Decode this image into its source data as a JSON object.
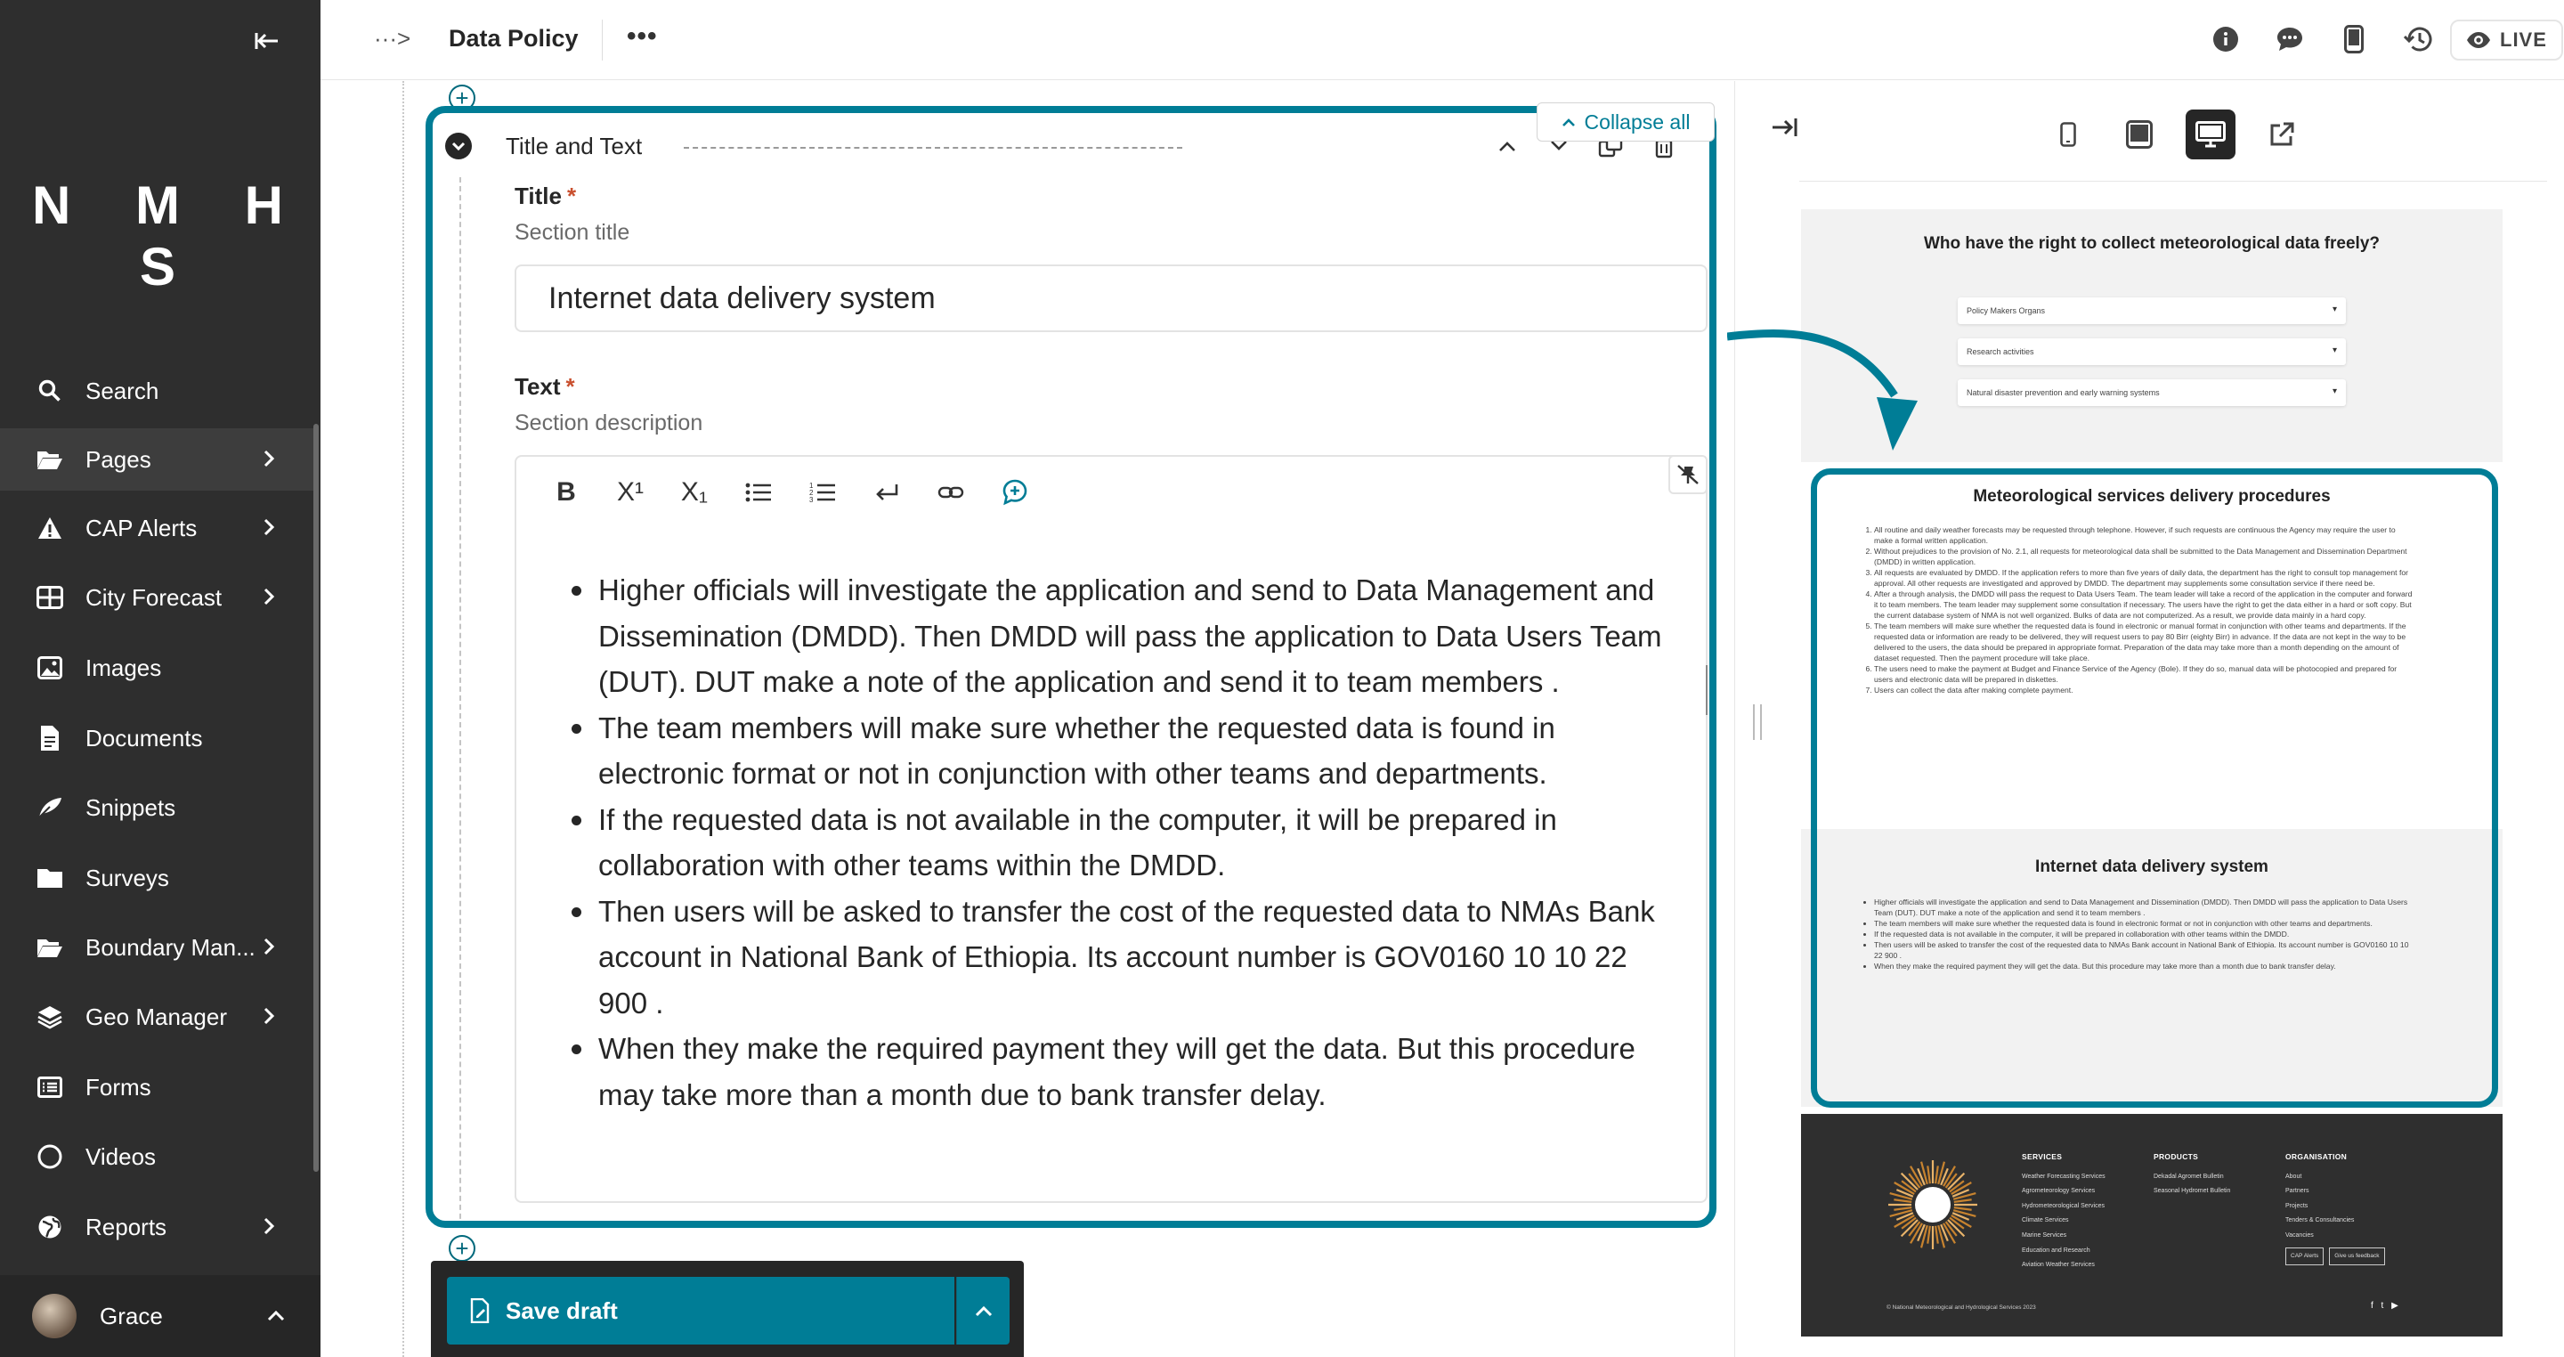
{
  "colors": {
    "sidebar_bg": "#2e2e2e",
    "accent": "#007d96",
    "required": "#c9502f"
  },
  "sidebar": {
    "logo": "N M H S",
    "items": [
      {
        "label": "Search",
        "icon": "search-icon",
        "has_children": false
      },
      {
        "label": "Pages",
        "icon": "folder-open-icon",
        "has_children": true
      },
      {
        "label": "CAP Alerts",
        "icon": "warning-icon",
        "has_children": true
      },
      {
        "label": "City Forecast",
        "icon": "table-icon",
        "has_children": true
      },
      {
        "label": "Images",
        "icon": "image-icon",
        "has_children": false
      },
      {
        "label": "Documents",
        "icon": "doc-icon",
        "has_children": false
      },
      {
        "label": "Snippets",
        "icon": "snippet-icon",
        "has_children": false
      },
      {
        "label": "Surveys",
        "icon": "folder-icon",
        "has_children": false
      },
      {
        "label": "Boundary Man...",
        "icon": "folder-open-icon",
        "has_children": true
      },
      {
        "label": "Geo Manager",
        "icon": "layers-icon",
        "has_children": true
      },
      {
        "label": "Forms",
        "icon": "list-icon",
        "has_children": false
      },
      {
        "label": "Videos",
        "icon": "circle-icon",
        "has_children": false
      },
      {
        "label": "Reports",
        "icon": "globe-icon",
        "has_children": true
      }
    ],
    "user": "Grace"
  },
  "header": {
    "breadcrumb_toggle": "···>",
    "title": "Data Policy",
    "more": "•••",
    "live": "LIVE"
  },
  "editor": {
    "collapse_all": "Collapse all",
    "block_title": "Title and Text",
    "title_field": {
      "label": "Title",
      "help": "Section title",
      "value": "Internet data delivery system"
    },
    "text_field": {
      "label": "Text",
      "help": "Section description"
    },
    "toolbar": {
      "bold": "B",
      "superscript": "X¹",
      "subscript": "X₁"
    },
    "bullets": [
      "Higher officials will investigate the application and send to Data Management and Dissemination (DMDD). Then DMDD will pass the application to Data Users Team (DUT). DUT make a note of the application and send it to team members .",
      "The team members will make sure whether the requested data is found in electronic format or not in conjunction with other teams and departments.",
      "If the requested data is not available in the computer, it will be prepared in collaboration with other teams within the DMDD.",
      "Then users will be asked to transfer the cost of the requested data to NMAs Bank account in National Bank of Ethiopia. Its account number is GOV0160 10 10 22 900 .",
      "When they make the required payment they will get the data. But this procedure may take more than a month due to bank transfer delay."
    ],
    "save_draft": "Save draft"
  },
  "preview": {
    "q_heading": "Who have the right to collect meteorological data freely?",
    "accordions": [
      "Policy Makers Organs",
      "Research activities",
      "Natural disaster prevention and early warning systems"
    ],
    "proc_heading": "Meteorological services delivery procedures",
    "proc_items": [
      "All routine and daily weather forecasts may be requested through telephone. However, if such requests are continuous the Agency may require the user to make a formal written application.",
      "Without prejudices to the provision of No. 2.1, all requests for meteorological data shall be submitted to the Data Management and Dissemination Department (DMDD) in written application.",
      "All requests are evaluated by DMDD. If the application refers to more than five years of daily data, the department has the right to consult top management for approval. All other requests are investigated and approved by DMDD. The department may supplements some consultation service if there need be.",
      "After a through analysis, the DMDD will pass the request to Data Users Team. The team leader will take a record of the application in the computer and forward it to team members. The team leader may supplement some consultation if necessary. The users have the right to get the data either in a hard or soft copy. But the current database system of NMA is not well organized. Bulks of data are not computerized. As a result, we provide data mainly in a hard copy.",
      "The team members will make sure whether the requested data is found in electronic or manual format in conjunction with other teams and departments. If the requested data or information are ready to be delivered, they will request users to pay 80 Birr (eighty Birr) in advance. If the data are not kept in the way to be delivered to the users, the data should be prepared in appropriate format. Preparation of the data may take more than a month depending on the amount of dataset requested. Then the payment procedure will take place.",
      "The users need to make the payment at Budget and Finance Service of the Agency (Bole). If they do so, manual data will be photocopied and prepared for users and electronic data will be prepared in diskettes.",
      "Users can collect the data after making complete payment."
    ],
    "internet_heading": "Internet data delivery system",
    "footer": {
      "services_title": "SERVICES",
      "services": [
        "Weather Forecasting Services",
        "Agrometeorology Services",
        "Hydrometeorological Services",
        "Climate Services",
        "Marine Services",
        "Education and Research",
        "Aviation Weather Services"
      ],
      "products_title": "PRODUCTS",
      "products": [
        "Dekadal Agromet Bulletin",
        "Seasonal Hydromet Bulletin"
      ],
      "org_title": "ORGANISATION",
      "org": [
        "About",
        "Partners",
        "Projects",
        "Tenders & Consultancies",
        "Vacancies"
      ],
      "btn_cap": "CAP Alerts",
      "btn_feedback": "Give us feedback",
      "copyright": "© National Meteorological and Hydrological Services 2023",
      "social": "f t ▶"
    }
  }
}
